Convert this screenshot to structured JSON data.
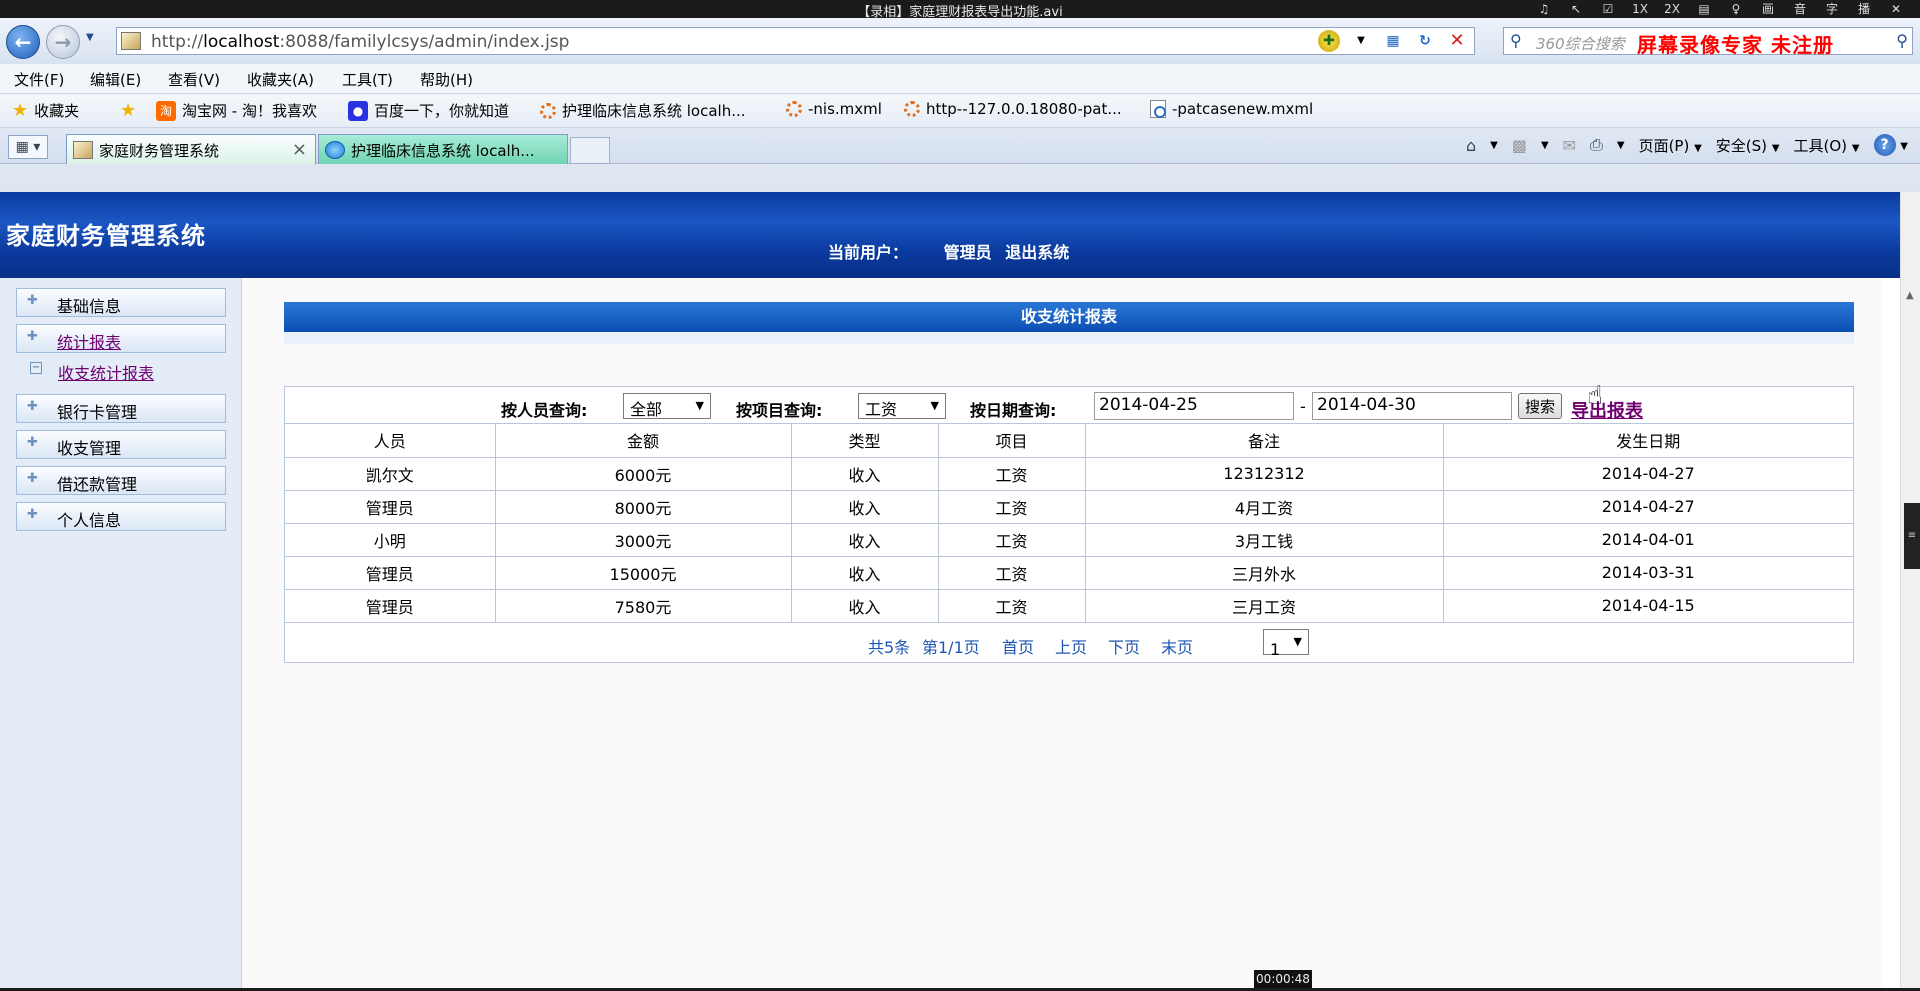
{
  "player": {
    "title": "【录相】家庭理财报表导出功能.avi",
    "controls": [
      "♫",
      "↖",
      "☑",
      "1X",
      "2X",
      "▤",
      "♀",
      "画",
      "音",
      "字",
      "播",
      "✕"
    ],
    "timecode": "00:00:48"
  },
  "browser": {
    "url_prefix": "http://",
    "url_host": "localhost",
    "url_rest": ":8088/familylcsys/admin/index.jsp",
    "search_placeholder": "360综合搜索",
    "watermark": "屏幕录像专家  未注册",
    "menu": [
      "文件(F)",
      "编辑(E)",
      "查看(V)",
      "收藏夹(A)",
      "工具(T)",
      "帮助(H)"
    ],
    "favorites_label": "收藏夹",
    "favorites": [
      {
        "label": "淘宝网 - 淘！我喜欢",
        "icon": "taobao-icon"
      },
      {
        "label": "百度一下，你就知道",
        "icon": "baidu-icon"
      },
      {
        "label": "护理临床信息系统 localh...",
        "icon": "loading-icon"
      },
      {
        "label": "-nis.mxml",
        "icon": "loading-icon"
      },
      {
        "label": "http--127.0.0.18080-pat...",
        "icon": "loading-icon"
      },
      {
        "label": "-patcasenew.mxml",
        "icon": "page-icon"
      }
    ],
    "tabs": [
      {
        "label": "家庭财务管理系统",
        "active": true
      },
      {
        "label": "护理临床信息系统 localh...",
        "active": false
      }
    ],
    "commands": {
      "page": "页面(P)",
      "safety": "安全(S)",
      "tools": "工具(O)"
    }
  },
  "app": {
    "brand": "家庭财务管理系统",
    "current_user_label": "当前用户：",
    "current_user": "管理员",
    "logout": "退出系统"
  },
  "sidebar": {
    "items": [
      {
        "label": "基础信息"
      },
      {
        "label": "统计报表"
      },
      {
        "label": "收支统计报表"
      },
      {
        "label": "银行卡管理"
      },
      {
        "label": "收支管理"
      },
      {
        "label": "借还款管理"
      },
      {
        "label": "个人信息"
      }
    ]
  },
  "report": {
    "title": "收支统计报表",
    "filters": {
      "person_label": "按人员查询:",
      "person_value": "全部",
      "item_label": "按项目查询:",
      "item_value": "工资",
      "date_label": "按日期查询:",
      "date_from": "2014-04-25",
      "date_sep": "-",
      "date_to": "2014-04-30",
      "search_button": "搜索",
      "export_link": "导出报表"
    },
    "columns": [
      "人员",
      "金额",
      "类型",
      "项目",
      "备注",
      "发生日期"
    ],
    "rows": [
      [
        "凯尔文",
        "6000元",
        "收入",
        "工资",
        "12312312",
        "2014-04-27"
      ],
      [
        "管理员",
        "8000元",
        "收入",
        "工资",
        "4月工资",
        "2014-04-27"
      ],
      [
        "小明",
        "3000元",
        "收入",
        "工资",
        "3月工钱",
        "2014-04-01"
      ],
      [
        "管理员",
        "15000元",
        "收入",
        "工资",
        "三月外水",
        "2014-03-31"
      ],
      [
        "管理员",
        "7580元",
        "收入",
        "工资",
        "三月工资",
        "2014-04-15"
      ]
    ],
    "pager": {
      "total": "共5条",
      "page_info": "第1/1页",
      "first": "首页",
      "prev": "上页",
      "next": "下页",
      "last": "末页",
      "page_select": "1"
    }
  }
}
